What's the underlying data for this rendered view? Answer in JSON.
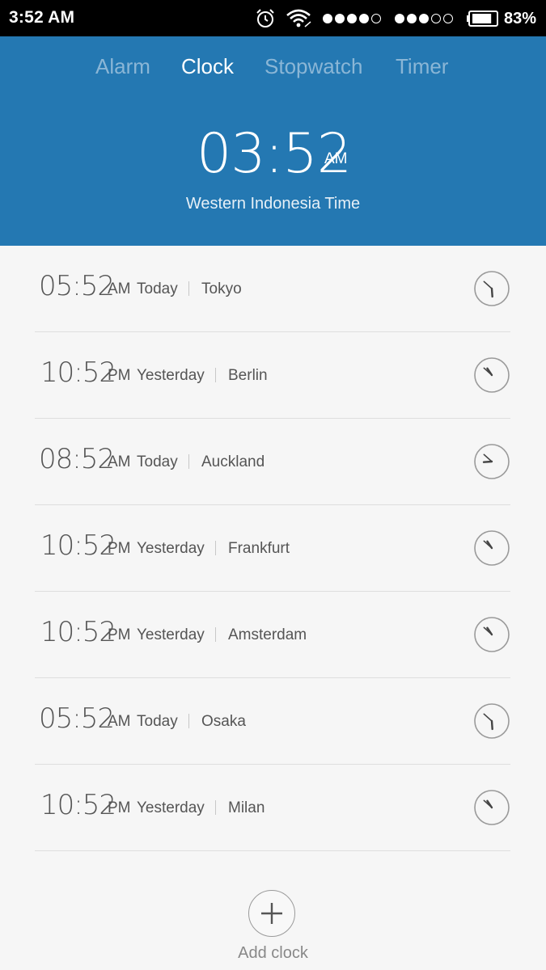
{
  "status_bar": {
    "time": "3:52 AM",
    "battery_percent": "83%",
    "battery_level": 0.83,
    "signal1_bars": [
      true,
      true,
      true,
      true,
      false
    ],
    "signal2_bars": [
      true,
      true,
      true,
      false,
      false
    ],
    "icons": [
      "alarm-icon",
      "wifi-icon",
      "signal-icon",
      "battery-icon"
    ]
  },
  "tabs": [
    {
      "label": "Alarm",
      "active": false
    },
    {
      "label": "Clock",
      "active": true
    },
    {
      "label": "Stopwatch",
      "active": false
    },
    {
      "label": "Timer",
      "active": false
    }
  ],
  "main_clock": {
    "time": "03:52",
    "ampm": "AM",
    "zone": "Western Indonesia Time"
  },
  "world_clocks": [
    {
      "time": "05:52",
      "ampm": "AM",
      "day": "Today",
      "city": "Tokyo",
      "hour": 5,
      "minute": 52
    },
    {
      "time": "10:52",
      "ampm": "PM",
      "day": "Yesterday",
      "city": "Berlin",
      "hour": 10,
      "minute": 52
    },
    {
      "time": "08:52",
      "ampm": "AM",
      "day": "Today",
      "city": "Auckland",
      "hour": 8,
      "minute": 52
    },
    {
      "time": "10:52",
      "ampm": "PM",
      "day": "Yesterday",
      "city": "Frankfurt",
      "hour": 10,
      "minute": 52
    },
    {
      "time": "10:52",
      "ampm": "PM",
      "day": "Yesterday",
      "city": "Amsterdam",
      "hour": 10,
      "minute": 52
    },
    {
      "time": "05:52",
      "ampm": "AM",
      "day": "Today",
      "city": "Osaka",
      "hour": 5,
      "minute": 52
    },
    {
      "time": "10:52",
      "ampm": "PM",
      "day": "Yesterday",
      "city": "Milan",
      "hour": 10,
      "minute": 52
    }
  ],
  "add_clock": {
    "label": "Add clock"
  },
  "colors": {
    "header_bg": "#2478b2",
    "tab_inactive": "#8ab6d6",
    "list_bg": "#f6f6f6"
  }
}
